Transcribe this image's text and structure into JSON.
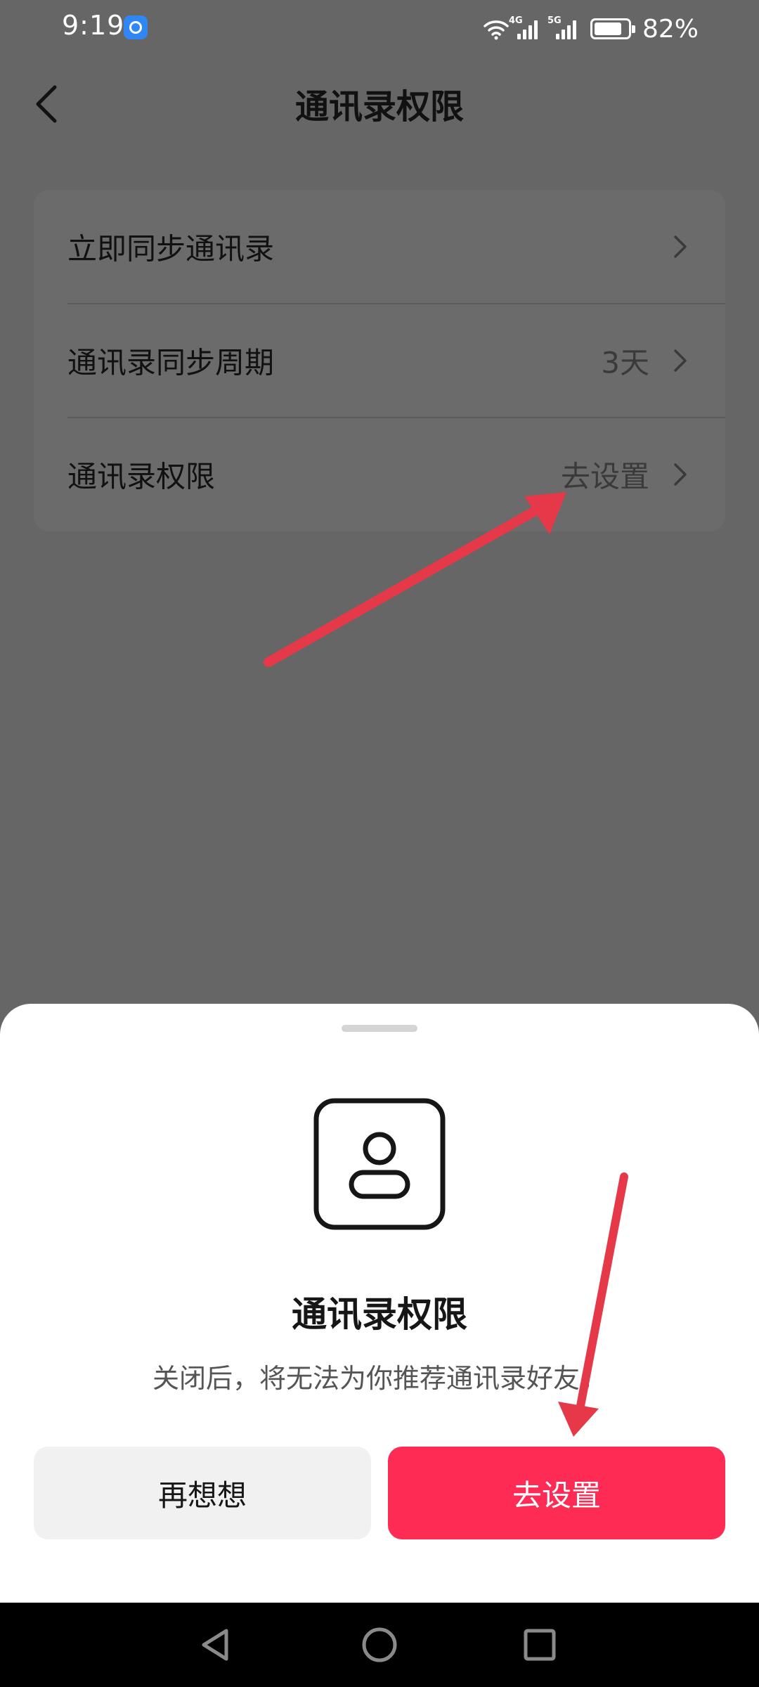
{
  "status_bar": {
    "time": "9:19",
    "app_icon": "app-notification-icon",
    "network_1": "4G",
    "network_2": "5G",
    "battery_percent": "82%",
    "battery_level": 0.82
  },
  "header": {
    "back_icon": "chevron-left-icon",
    "title": "通讯录权限"
  },
  "settings": {
    "items": [
      {
        "label": "立即同步通讯录",
        "value": ""
      },
      {
        "label": "通讯录同步周期",
        "value": "3天"
      },
      {
        "label": "通讯录权限",
        "value": "去设置"
      }
    ]
  },
  "sheet": {
    "icon": "contact-person-icon",
    "title": "通讯录权限",
    "description": "关闭后，将无法为你推荐通讯录好友。",
    "cancel_label": "再想想",
    "confirm_label": "去设置"
  },
  "nav_bar": {
    "back_icon": "triangle-back-icon",
    "home_icon": "circle-home-icon",
    "recents_icon": "square-recents-icon"
  },
  "colors": {
    "overlay_bg": "#666666",
    "accent": "#fe2c55",
    "arrow": "#e5394a"
  }
}
